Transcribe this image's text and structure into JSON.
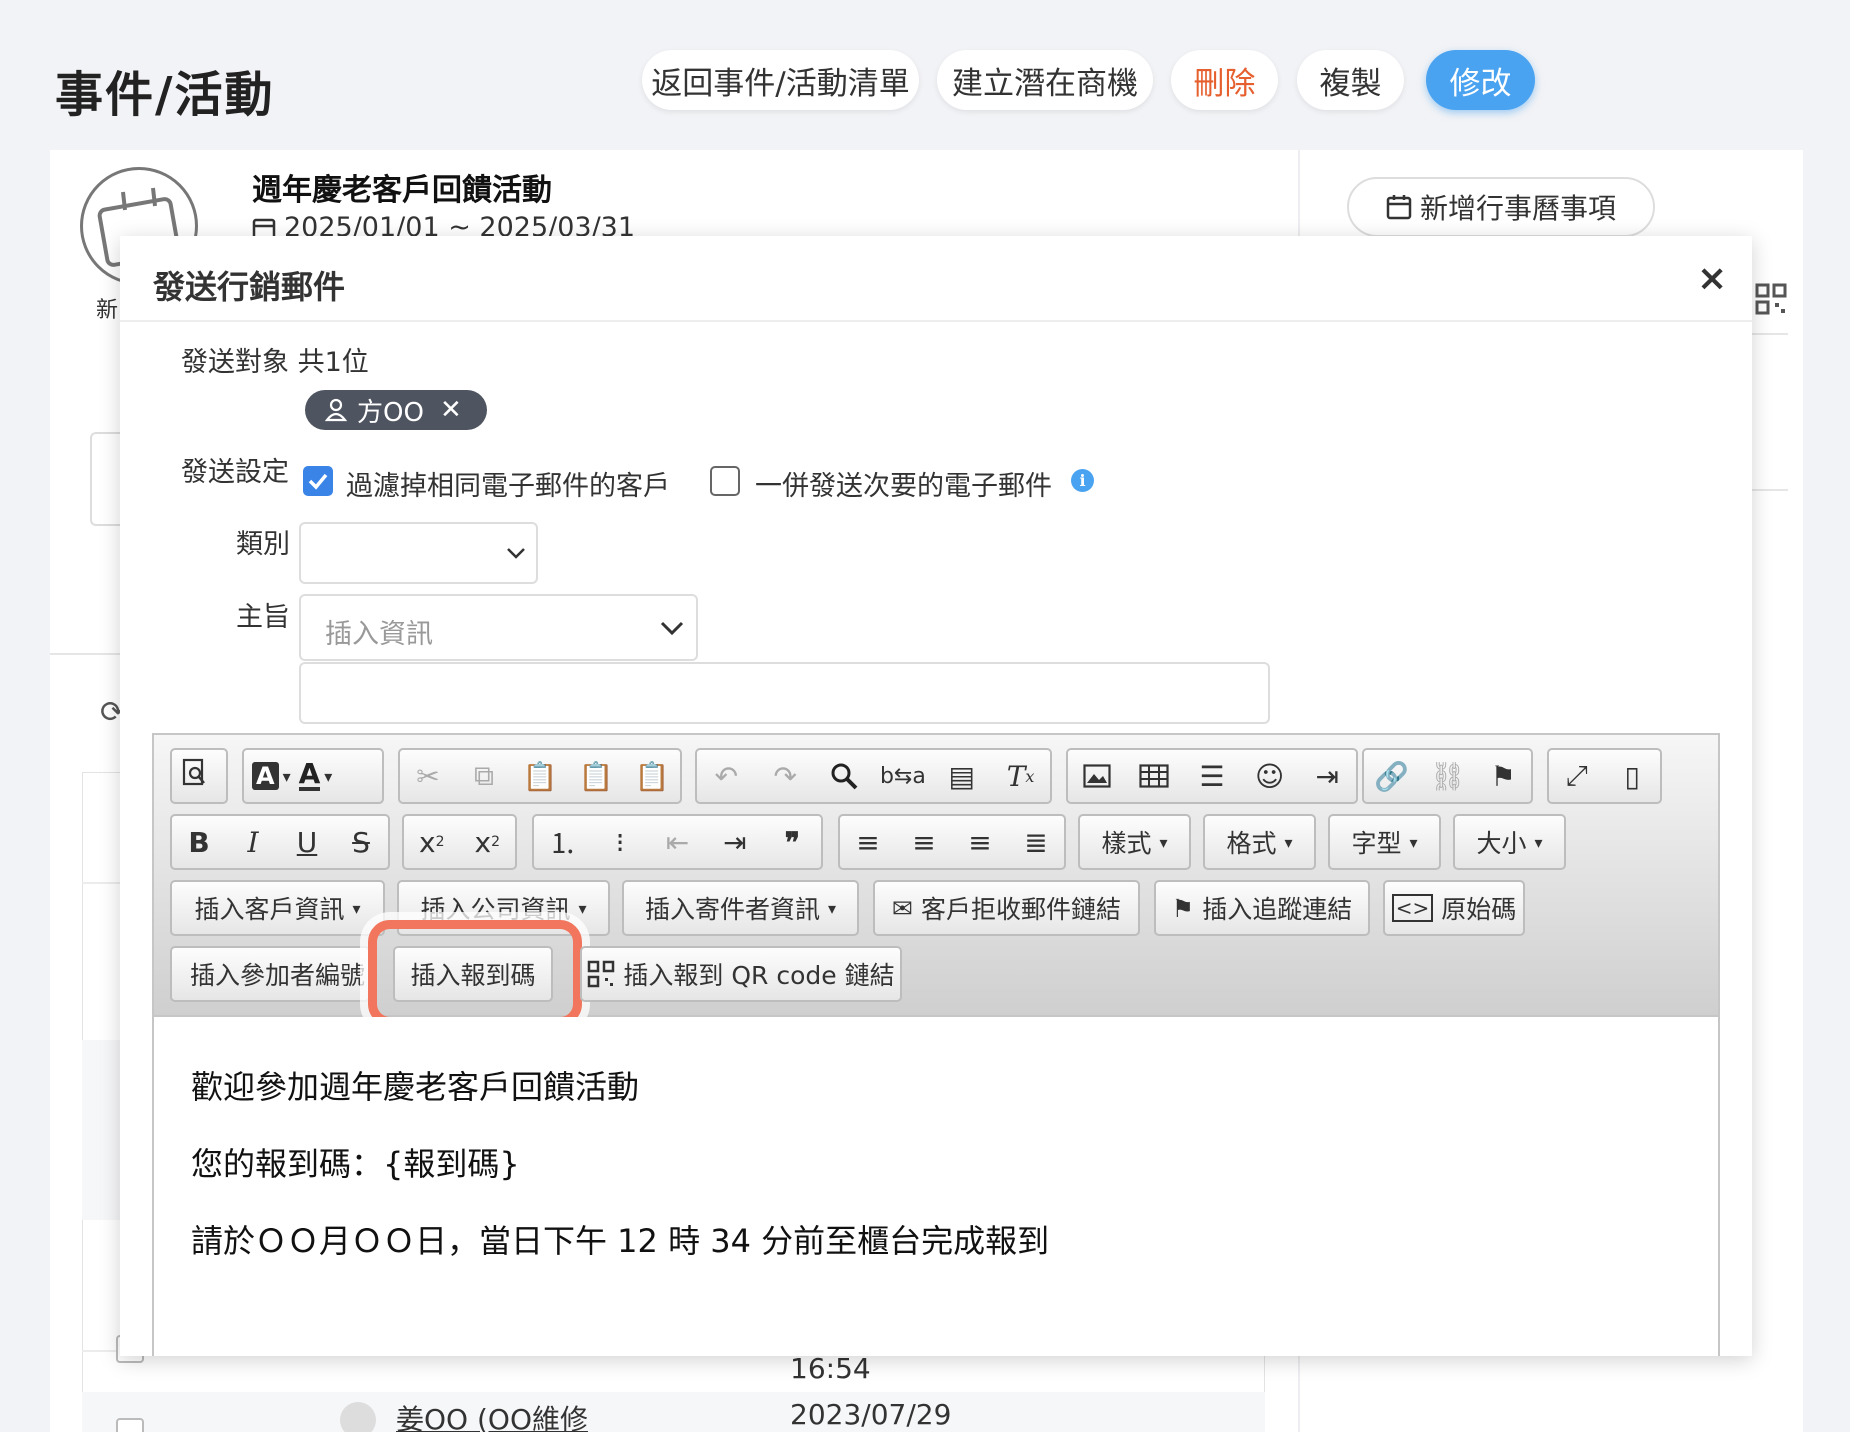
{
  "header": {
    "title": "事件/活動",
    "buttons": {
      "back": "返回事件/活動清單",
      "create_opportunity": "建立潛在商機",
      "delete": "刪除",
      "copy": "複製",
      "edit": "修改"
    }
  },
  "event": {
    "title": "週年慶老客戶回饋活動",
    "date": "2025/01/01 ~ 2025/03/31",
    "add_calendar": "新增行事曆事項",
    "avatar_caption": "新",
    "rows": [
      {
        "time": "16:54"
      },
      {
        "name": "姜OO (OO維修",
        "date": "2023/07/29"
      }
    ]
  },
  "modal": {
    "title": "發送行銷郵件",
    "close": "×",
    "recipients_label": "發送對象 共1位",
    "recipient_chip": "方OO",
    "settings_label": "發送設定",
    "filter_dup_label": "過濾掉相同電子郵件的客戶",
    "filter_dup_checked": true,
    "send_secondary_label": "一併發送次要的電子郵件",
    "send_secondary_checked": false,
    "category_label": "類別",
    "category_value": "",
    "subject_label": "主旨",
    "insert_info_placeholder": "插入資訊",
    "subject_value": ""
  },
  "toolbar": {
    "row2": {
      "styles": "樣式",
      "format": "格式",
      "font": "字型",
      "size": "大小"
    },
    "row3": {
      "insert_customer": "插入客戶資訊",
      "insert_company": "插入公司資訊",
      "insert_sender": "插入寄件者資訊",
      "unsubscribe_link": "客戶拒收郵件鏈結",
      "tracking_link": "插入追蹤連結",
      "source": "原始碼"
    },
    "row4": {
      "participant_no": "插入參加者編號",
      "checkin_code": "插入報到碼",
      "checkin_qr": "插入報到 QR code 鏈結"
    }
  },
  "editor_body": {
    "line1": "歡迎參加週年慶老客戶回饋活動",
    "line2": "您的報到碼：{報到碼}",
    "line3": "請於ＯＯ月ＯＯ日，當日下午 12 時 34 分前至櫃台完成報到"
  },
  "colors": {
    "primary": "#4aa3f0",
    "danger": "#e6602f",
    "highlight": "#f2765d",
    "chip": "#4f5560",
    "checkbox": "#3a84e8"
  }
}
